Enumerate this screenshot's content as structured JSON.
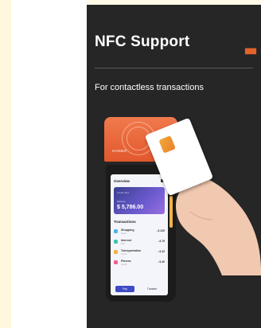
{
  "poster": {
    "title": "NFC Support",
    "subtitle": "For contactless transactions",
    "accent_color": "#e3642b"
  },
  "device": {
    "brand": "HANBO",
    "screen": {
      "overview_title": "Overview",
      "card_small": "Credit card",
      "balance_label": "Balance",
      "balance": "$ 5,786.00",
      "transactions_title": "Transactions",
      "transactions": [
        {
          "name": "Shopping",
          "sub": "Retail",
          "amount": "- $ 225",
          "color": "#4ab6e8"
        },
        {
          "name": "Internet",
          "sub": "Bills",
          "amount": "- $ 75",
          "color": "#3fc7b0"
        },
        {
          "name": "Transportation",
          "sub": "Travel",
          "amount": "- $ 32",
          "color": "#f2b23c"
        },
        {
          "name": "Fitness",
          "sub": "Health",
          "amount": "- $ 40",
          "color": "#ef5f8c"
        }
      ],
      "pay_label": "Pay",
      "transfer_label": "Transfer"
    }
  }
}
